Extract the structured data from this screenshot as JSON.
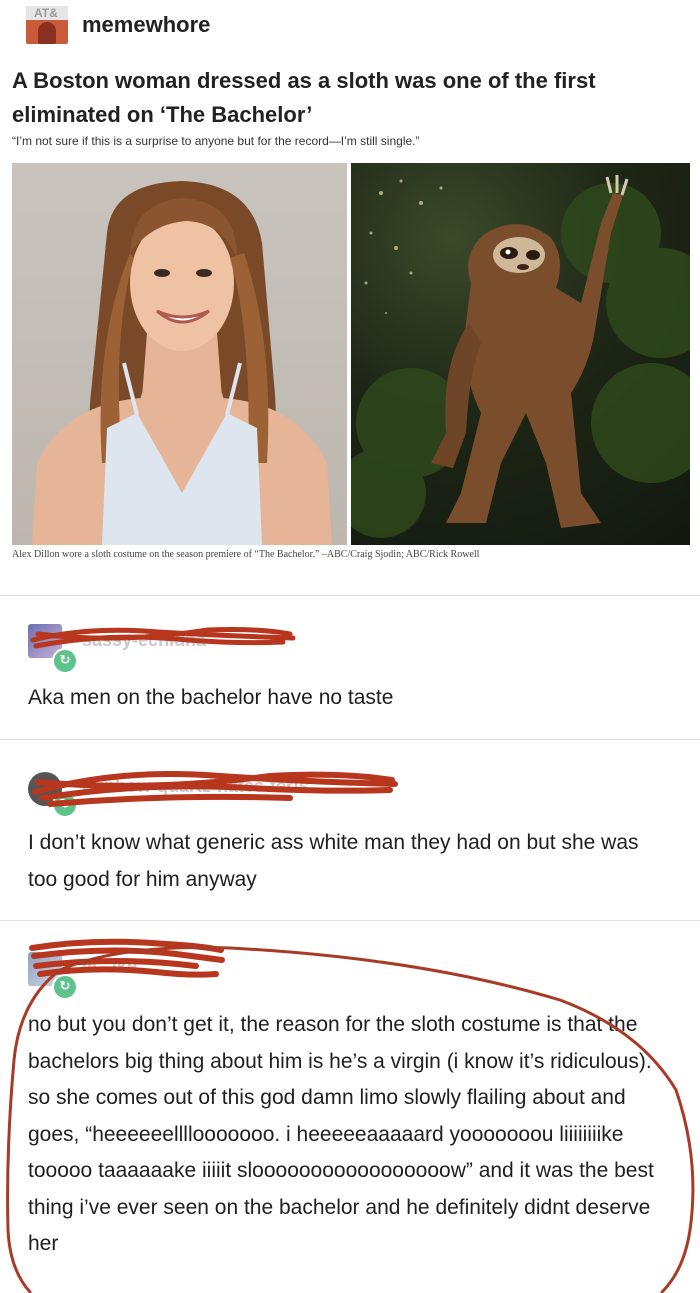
{
  "post": {
    "username": "memewhore",
    "avatar_tag": "AT&",
    "headline": "A Boston woman dressed as a sloth was one of the first eliminated on ‘The Bachelor’",
    "subhead": "“I’m not sure if this is a surprise to anyone but for the record—I’m still single.”",
    "caption": "Alex Dillon wore a sloth costume on the season premiere of “The Bachelor.” –ABC/Craig Sjodin; ABC/Rick Rowell"
  },
  "replies": [
    {
      "username": "sassy-echidna",
      "text": "Aka men on the bachelor have no taste"
    },
    {
      "username": "rainbow-quartz-hates-terfs",
      "text": "I don’t know what generic ass white man they had on but she was too good for him anyway"
    },
    {
      "username": "lli...ike",
      "text": "no but you don’t get it, the reason for the sloth costume is that the bachelors big thing about him is he’s a virgin (i know it’s ridiculous). so she comes out of this god damn limo slowly flailing about and goes, “heeeeeellllooooooo. i heeeeeaaaaard yooooooou liiiiiiiike tooooo taaaaaake iiiiit slooooooooooooooooow” and it was the best thing i’ve ever seen on the bachelor and he definitely didnt deserve her"
    }
  ],
  "colors": {
    "scribble": "#b8361e",
    "reblog_badge": "#5ec48c",
    "circle_annotation": "#a83a26"
  },
  "icons": {
    "reblog": "reblog-icon"
  }
}
